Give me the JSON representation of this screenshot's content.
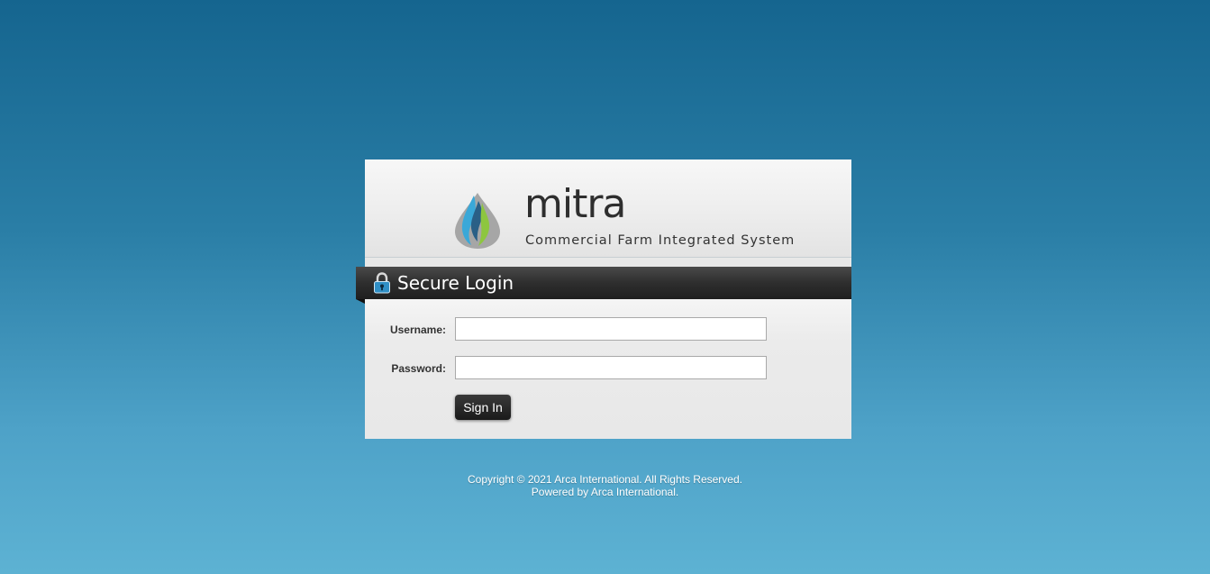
{
  "brand": {
    "name": "mitra",
    "tagline": "Commercial Farm Integrated System",
    "logo_icon": "water-drop-logo-icon",
    "logo_colors": [
      "#a3a3a3",
      "#3aa8d8",
      "#2a5f86",
      "#8dc63f"
    ]
  },
  "login": {
    "title": "Secure Login",
    "lock_icon": "padlock-icon",
    "username_label": "Username:",
    "username_value": "",
    "password_label": "Password:",
    "password_value": "",
    "signin_label": "Sign In"
  },
  "footer": {
    "copyright": "Copyright © 2021 Arca International. All Rights Reserved.",
    "powered_by": "Powered by Arca International."
  },
  "colors": {
    "background_top": "#15658f",
    "background_bottom": "#5db2d3",
    "banner": "#2e2e2e",
    "button": "#1a1a1a"
  }
}
